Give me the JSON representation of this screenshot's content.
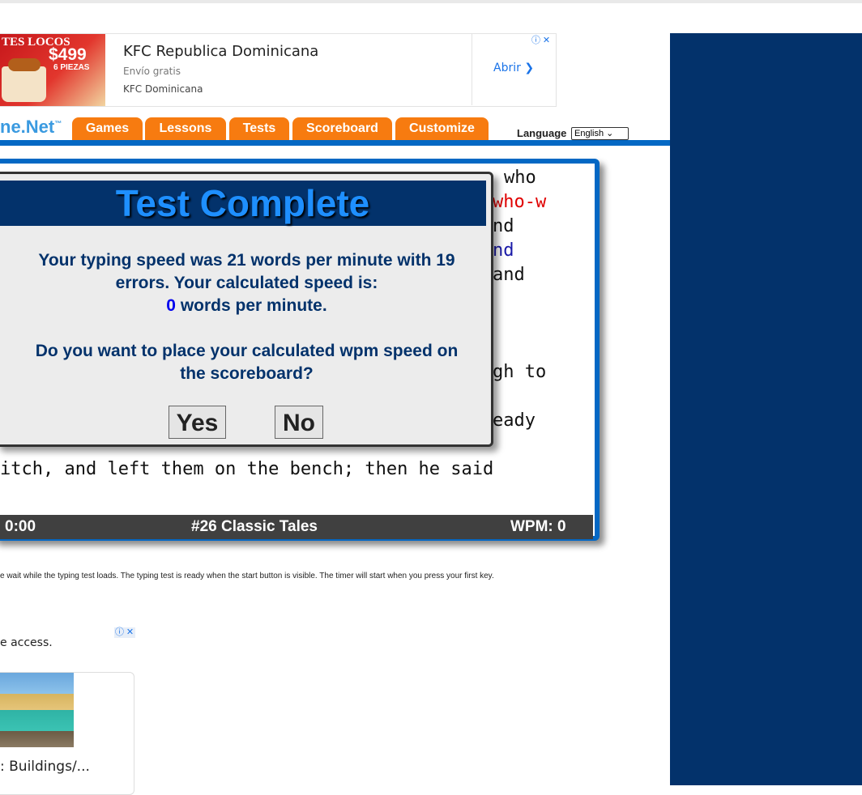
{
  "ad_top": {
    "image_text_1": "TES LOCOS",
    "image_price": "$499",
    "image_text_2": "6 PIEZAS",
    "title": "KFC Republica Dominicana",
    "subtitle": "Envío gratis",
    "brand": "KFC Dominicana",
    "open_label": "Abrir ❯",
    "info_icon": "ⓘ",
    "close_icon": "✕"
  },
  "nav": {
    "logo": "ne.Net",
    "logo_tm": "™",
    "tabs": [
      "Games",
      "Lessons",
      "Tests",
      "Scoreboard",
      "Customize"
    ],
    "language_label": "Language",
    "language_value": "English ⌄"
  },
  "test_text": {
    "line1": "who",
    "line2": "who-w",
    "line3": "nd",
    "line4": "nd",
    "line5": "and",
    "line6": "gh to",
    "line7": "eady",
    "line8": "itch, and left them on the bench; then he said"
  },
  "status_bar": {
    "timer": "0:00",
    "test_name": "#26 Classic Tales",
    "wpm": "WPM: 0"
  },
  "modal": {
    "title": "Test Complete",
    "line1": "Your typing speed was 21 words per minute with 19",
    "line2": "errors. Your calculated speed is:",
    "calc_speed": "0",
    "line3_suffix": " words per minute.",
    "question1": "Do you want to place your calculated wpm speed on",
    "question2": "the scoreboard?",
    "yes_label": "Yes",
    "no_label": "No"
  },
  "note": "e wait while the typing test loads. The typing test is ready when the start button is visible. The timer will start when you press your first key.",
  "ad_bottom": {
    "text": "e access.",
    "caption": ": Buildings/..."
  },
  "colors": {
    "navy": "#03326b",
    "tab_orange": "#f77b10",
    "frame_blue": "#0468c4",
    "title_blue": "#1e8fff",
    "error_red": "#e00000"
  }
}
